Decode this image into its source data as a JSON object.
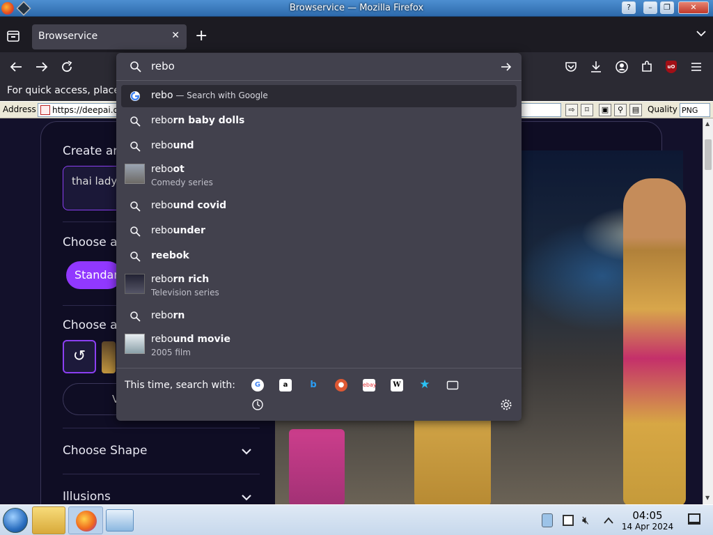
{
  "window": {
    "title": "Browservice — Mozilla Firefox"
  },
  "tabs": {
    "active_label": "Browservice"
  },
  "bookmarks_notice": "For quick access, place",
  "addressbar": {
    "label": "Address",
    "url": "https://deepai.or",
    "quality_label": "Quality",
    "quality_value": "PNG"
  },
  "urlbar": {
    "query": "rebo",
    "suggestions": [
      {
        "prefix": "rebo",
        "rest": "",
        "suffix": " — Search with Google",
        "sub": "",
        "icon": "google-icon"
      },
      {
        "prefix": "rebo",
        "rest": "rn baby dolls",
        "suffix": "",
        "sub": "",
        "icon": "search-icon"
      },
      {
        "prefix": "rebo",
        "rest": "und",
        "suffix": "",
        "sub": "",
        "icon": "search-icon"
      },
      {
        "prefix": "rebo",
        "rest": "ot",
        "suffix": "",
        "sub": "Comedy series",
        "icon": "thumbnail"
      },
      {
        "prefix": "rebo",
        "rest": "und covid",
        "suffix": "",
        "sub": "",
        "icon": "search-icon"
      },
      {
        "prefix": "rebo",
        "rest": "under",
        "suffix": "",
        "sub": "",
        "icon": "search-icon"
      },
      {
        "prefix": "",
        "rest": "reebok",
        "suffix": "",
        "sub": "",
        "icon": "search-icon"
      },
      {
        "prefix": "rebo",
        "rest": "rn rich",
        "suffix": "",
        "sub": "Television series",
        "icon": "thumbnail"
      },
      {
        "prefix": "rebo",
        "rest": "rn",
        "suffix": "",
        "sub": "",
        "icon": "search-icon"
      },
      {
        "prefix": "rebo",
        "rest": "und movie",
        "suffix": "",
        "sub": "2005 film",
        "icon": "thumbnail"
      }
    ],
    "one_off_label": "This time, search with:",
    "engines": [
      "Google",
      "Amazon",
      "Bing",
      "DuckDuckGo",
      "eBay",
      "Wikipedia",
      "Bookmarks",
      "Tabs",
      "History"
    ]
  },
  "page": {
    "create_label": "Create an",
    "prompt_text": "thai ladyb reassignm",
    "choose_a_1": "Choose a",
    "standard_btn": "Standard",
    "choose_a_2": "Choose a",
    "view_btn": "V",
    "choose_shape": "Choose Shape",
    "illusions": "Illusions"
  },
  "taskbar": {
    "time": "04:05",
    "date": "14 Apr 2024"
  },
  "colors": {
    "accent": "#9138ff",
    "popup_bg": "#42414d",
    "selected_row": "#2b2a33"
  }
}
